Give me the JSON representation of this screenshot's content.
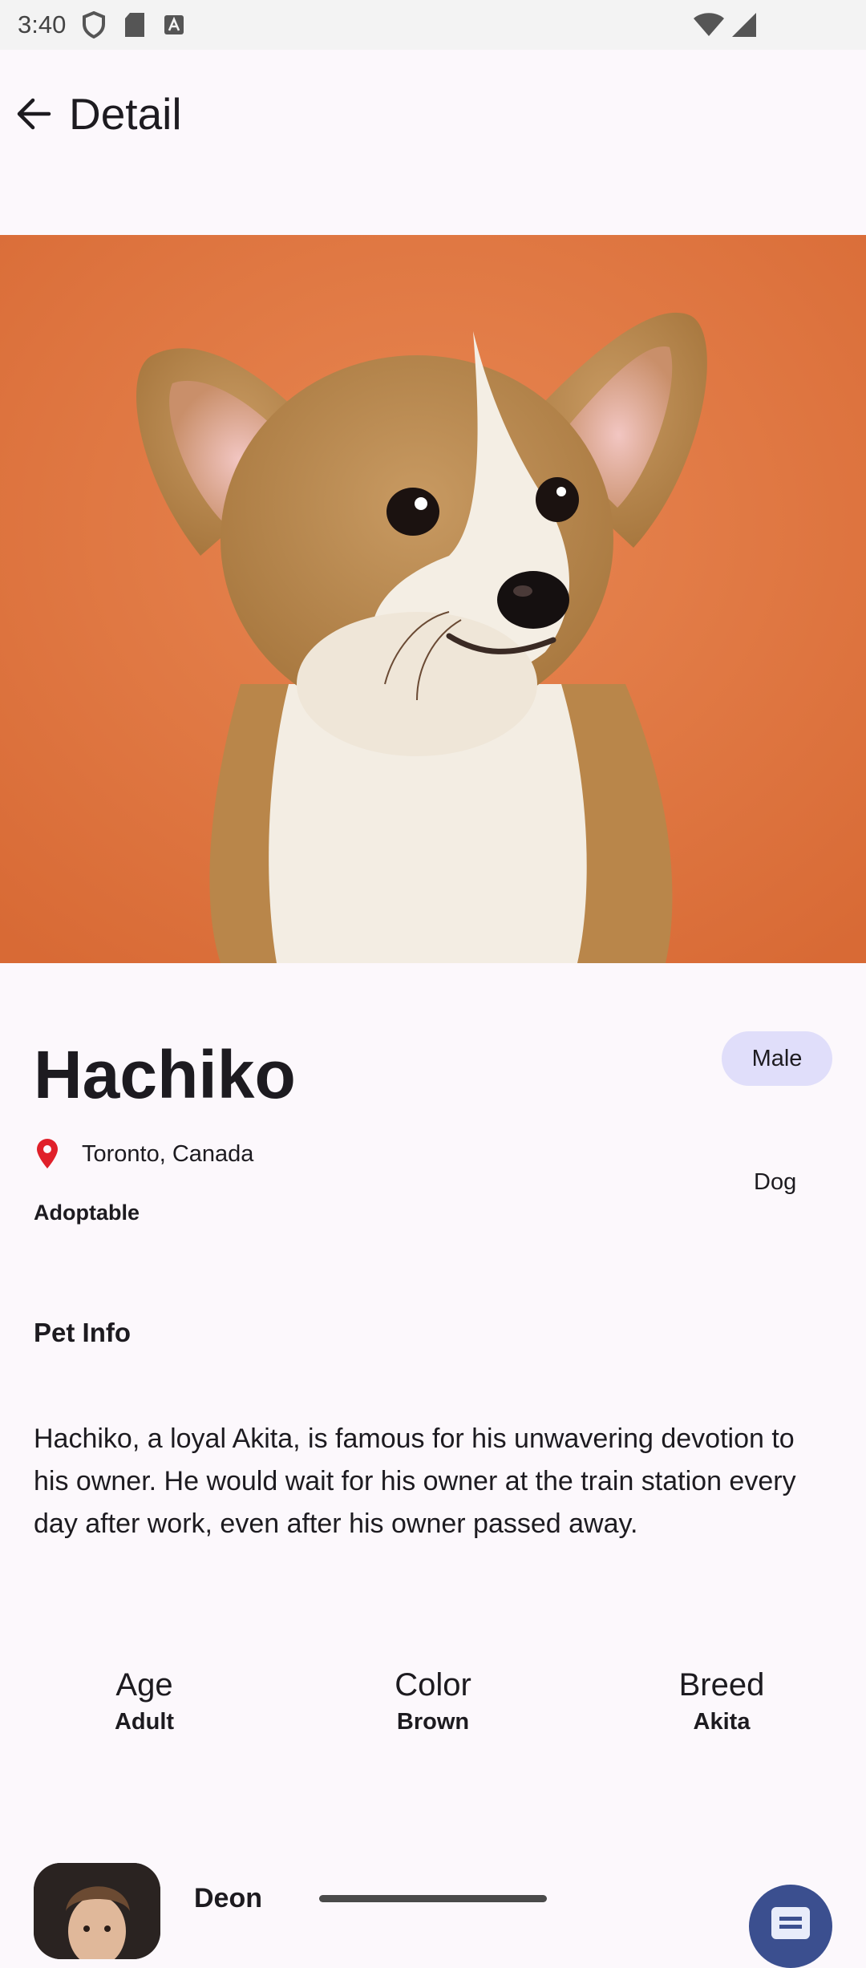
{
  "status_bar": {
    "time": "3:40"
  },
  "top_bar": {
    "title": "Detail"
  },
  "pet": {
    "name": "Hachiko",
    "gender": "Male",
    "location": "Toronto, Canada",
    "species": "Dog",
    "status": "Adoptable",
    "section_title": "Pet Info",
    "description": "Hachiko, a loyal Akita, is famous for his unwavering devotion to his owner. He would wait for his owner at the train station every day after work, even after his owner passed away.",
    "info": [
      {
        "label": "Age",
        "value": "Adult"
      },
      {
        "label": "Color",
        "value": "Brown"
      },
      {
        "label": "Breed",
        "value": "Akita"
      }
    ]
  },
  "owner": {
    "name": "Deon"
  },
  "colors": {
    "accent_chip": "#e0defa",
    "fab": "#3b4f8f",
    "hero_background": "#e27c45",
    "location_pin": "#e0202a"
  },
  "icons": {
    "back": "arrow-left-icon",
    "location": "location-pin-icon",
    "message": "message-icon"
  }
}
